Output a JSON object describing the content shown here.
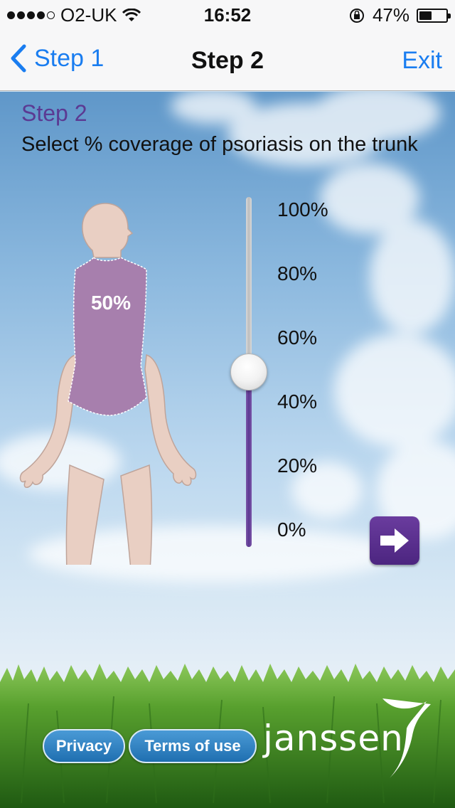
{
  "status_bar": {
    "carrier": "O2-UK",
    "time": "16:52",
    "battery_percent": "47%",
    "battery_level": 0.47,
    "signal_bars_filled": 4,
    "icons": [
      "signal-dots-icon",
      "wifi-icon",
      "orientation-lock-icon",
      "battery-icon"
    ]
  },
  "nav": {
    "back_label": "Step 1",
    "title": "Step 2",
    "exit_label": "Exit"
  },
  "step": {
    "heading": "Step 2",
    "instruction": "Select % coverage of psoriasis on the trunk"
  },
  "body_map": {
    "coverage_label": "50%",
    "highlighted_region": "trunk",
    "skin_color": "#e9cfc3",
    "highlight_color": "#a77fad"
  },
  "slider": {
    "value_percent": 50,
    "min": 0,
    "max": 100,
    "ticks": [
      "100%",
      "80%",
      "60%",
      "40%",
      "20%",
      "0%"
    ],
    "fill_color": "#5c3892"
  },
  "next_button": {
    "icon": "arrow-right-icon",
    "color": "#5a2f8e"
  },
  "footer": {
    "privacy_label": "Privacy",
    "terms_label": "Terms of use",
    "brand": "janssen"
  },
  "colors": {
    "ios_blue": "#1a7df0",
    "step_purple": "#5b3a93"
  }
}
